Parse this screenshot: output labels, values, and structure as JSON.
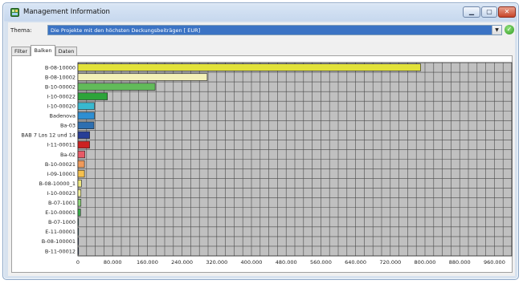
{
  "window": {
    "title": "Management Information"
  },
  "thema": {
    "label": "Thema:",
    "value": "Die Projekte mit den höchsten Deckungsbeiträgen [ EUR]"
  },
  "tabs": [
    {
      "label": "Filter",
      "active": false
    },
    {
      "label": "Balken",
      "active": true
    },
    {
      "label": "Daten",
      "active": false
    }
  ],
  "icons": {
    "app": "app-icon",
    "dropdown": "chevron-down-icon",
    "apply": "checkmark-icon",
    "minimize": "minimize-icon",
    "maximize": "maximize-icon",
    "close": "close-icon"
  },
  "chart_data": {
    "type": "bar",
    "orientation": "horizontal",
    "title": "",
    "xlabel": "",
    "ylabel": "",
    "xlim": [
      0,
      1000000
    ],
    "ticks": [
      0,
      80000,
      160000,
      240000,
      320000,
      400000,
      480000,
      560000,
      640000,
      720000,
      800000,
      880000,
      960000
    ],
    "tick_labels": [
      "0",
      "80.000",
      "160.000",
      "240.000",
      "320.000",
      "400.000",
      "480.000",
      "560.000",
      "640.000",
      "720.000",
      "800.000",
      "880.000",
      "960.000"
    ],
    "grid": true,
    "categories": [
      "B-08-10000",
      "B-08-10002",
      "B-10-00002",
      "I-10-00022",
      "I-10-00020",
      "Badenova",
      "Ba-03",
      "BAB 7 Los 12 und 14",
      "I-11-00011",
      "Ba-02",
      "B-10-00021",
      "I-09-10001",
      "B-08-10000_1",
      "I-10-00023",
      "B-07-1001",
      "E-10-00001",
      "B-07-1000",
      "E-11-00001",
      "B-08-100001",
      "B-11-00012"
    ],
    "values": [
      790000,
      298000,
      178000,
      68000,
      38000,
      38000,
      37000,
      27000,
      27000,
      16000,
      15000,
      15000,
      8000,
      7000,
      7000,
      6000,
      1000,
      1000,
      1000,
      1000
    ],
    "colors": [
      "#e2e23a",
      "#f3f0b8",
      "#62bb5a",
      "#2da43a",
      "#39b8cf",
      "#2e8fd2",
      "#2e6fb0",
      "#273e96",
      "#cc2222",
      "#e85a66",
      "#f09a5a",
      "#f5c04e",
      "#eee77e",
      "#f0ee9a",
      "#8dd47a",
      "#3ab04b",
      "#4dbab4",
      "#3aa0c0",
      "#4a70c0",
      "#3b5fa3"
    ],
    "background": "#c0c0c0"
  }
}
